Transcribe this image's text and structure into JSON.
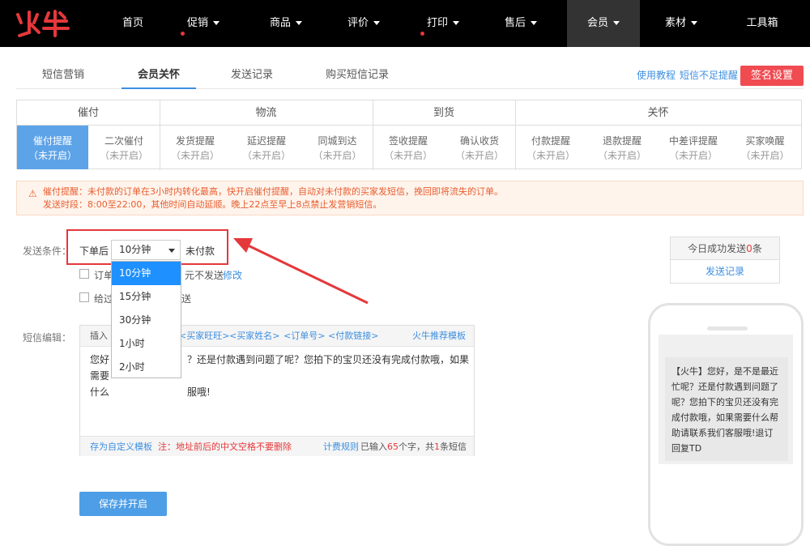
{
  "brand": {
    "logo_text": "火牛"
  },
  "topnav": [
    {
      "label": "首页",
      "dot": false,
      "caret": false
    },
    {
      "label": "促销",
      "dot": true,
      "caret": true
    },
    {
      "label": "商品",
      "dot": false,
      "caret": true
    },
    {
      "label": "评价",
      "dot": false,
      "caret": true
    },
    {
      "label": "打印",
      "dot": true,
      "caret": true
    },
    {
      "label": "售后",
      "dot": false,
      "caret": true
    },
    {
      "label": "会员",
      "dot": false,
      "caret": true,
      "active": true
    },
    {
      "label": "素材",
      "dot": false,
      "caret": true
    },
    {
      "label": "工具箱",
      "dot": false,
      "caret": false
    }
  ],
  "tabs": [
    {
      "label": "短信营销"
    },
    {
      "label": "会员关怀",
      "active": true
    },
    {
      "label": "发送记录"
    },
    {
      "label": "购买短信记录"
    }
  ],
  "toplinks": {
    "tutorial": "使用教程",
    "low_balance": "短信不足提醒",
    "sign_btn": "签名设置"
  },
  "groups": [
    {
      "name": "催付",
      "items": [
        {
          "title": "催付提醒",
          "status": "（未开启）",
          "active": true
        },
        {
          "title": "二次催付",
          "status": "（未开启）"
        }
      ]
    },
    {
      "name": "物流",
      "items": [
        {
          "title": "发货提醒",
          "status": "（未开启）"
        },
        {
          "title": "延迟提醒",
          "status": "（未开启）"
        },
        {
          "title": "同城到达",
          "status": "（未开启）"
        }
      ]
    },
    {
      "name": "到货",
      "items": [
        {
          "title": "签收提醒",
          "status": "（未开启）"
        },
        {
          "title": "确认收货",
          "status": "（未开启）"
        }
      ]
    },
    {
      "name": "关怀",
      "items": [
        {
          "title": "付款提醒",
          "status": "（未开启）"
        },
        {
          "title": "退款提醒",
          "status": "（未开启）"
        },
        {
          "title": "中差评提醒",
          "status": "（未开启）"
        },
        {
          "title": "买家唤醒",
          "status": "（未开启）"
        }
      ]
    }
  ],
  "alert": {
    "line1": "催付提醒：未付款的订单在3小时内转化最高，快开启催付提醒，自动对未付款的买家发短信，挽回即将流失的订单。",
    "line2": "发送时段：8:00至22:00，其他时间自动延顺。晚上22点至早上8点禁止发营销短信。"
  },
  "condition": {
    "label": "发送条件：",
    "prefix": "下单后",
    "selected": "10分钟",
    "suffix": "未付款",
    "options": [
      "10分钟",
      "15分钟",
      "30分钟",
      "1小时",
      "2小时"
    ],
    "cb1_prefix": "订单",
    "cb1_suffix": "元不发送",
    "cb1_link": "修改",
    "cb2_prefix": "给过",
    "cb2_suffix": "送"
  },
  "sms": {
    "label": "短信编辑：",
    "insert": "插入",
    "vars": [
      "<买家旺旺>",
      "<买家姓名>",
      "<订单号>",
      "<付款链接>"
    ],
    "recommend": "火牛推荐模板",
    "line1_a": "您好",
    "line1_b": "？还是付款遇到问题了呢？您拍下的宝贝还没有完成付款哦，如果需要",
    "line2_a": "什么",
    "line2_b": "服哦!",
    "save_custom": "存为自定义模板",
    "note": "注：地址前后的中文空格不要删除",
    "billing": "计费规则",
    "count_a": "已输入",
    "count_chars": "65",
    "count_b": "个字，共",
    "count_msgs": "1",
    "count_c": "条短信"
  },
  "stats": {
    "today_a": "今日成功发送",
    "today_num": "0",
    "today_b": "条",
    "link": "发送记录"
  },
  "preview": {
    "text": "【火牛】您好，是不是最近忙呢？还是付款遇到问题了呢？您拍下的宝贝还没有完成付款哦，如果需要什么帮助请联系我们客服哦!退订回复TD"
  },
  "save_button": "保存并开启",
  "colors": {
    "nav_bg": "#000000",
    "accent": "#3d8fe0",
    "red": "#e5383b",
    "active_cell": "#5da3e8"
  }
}
